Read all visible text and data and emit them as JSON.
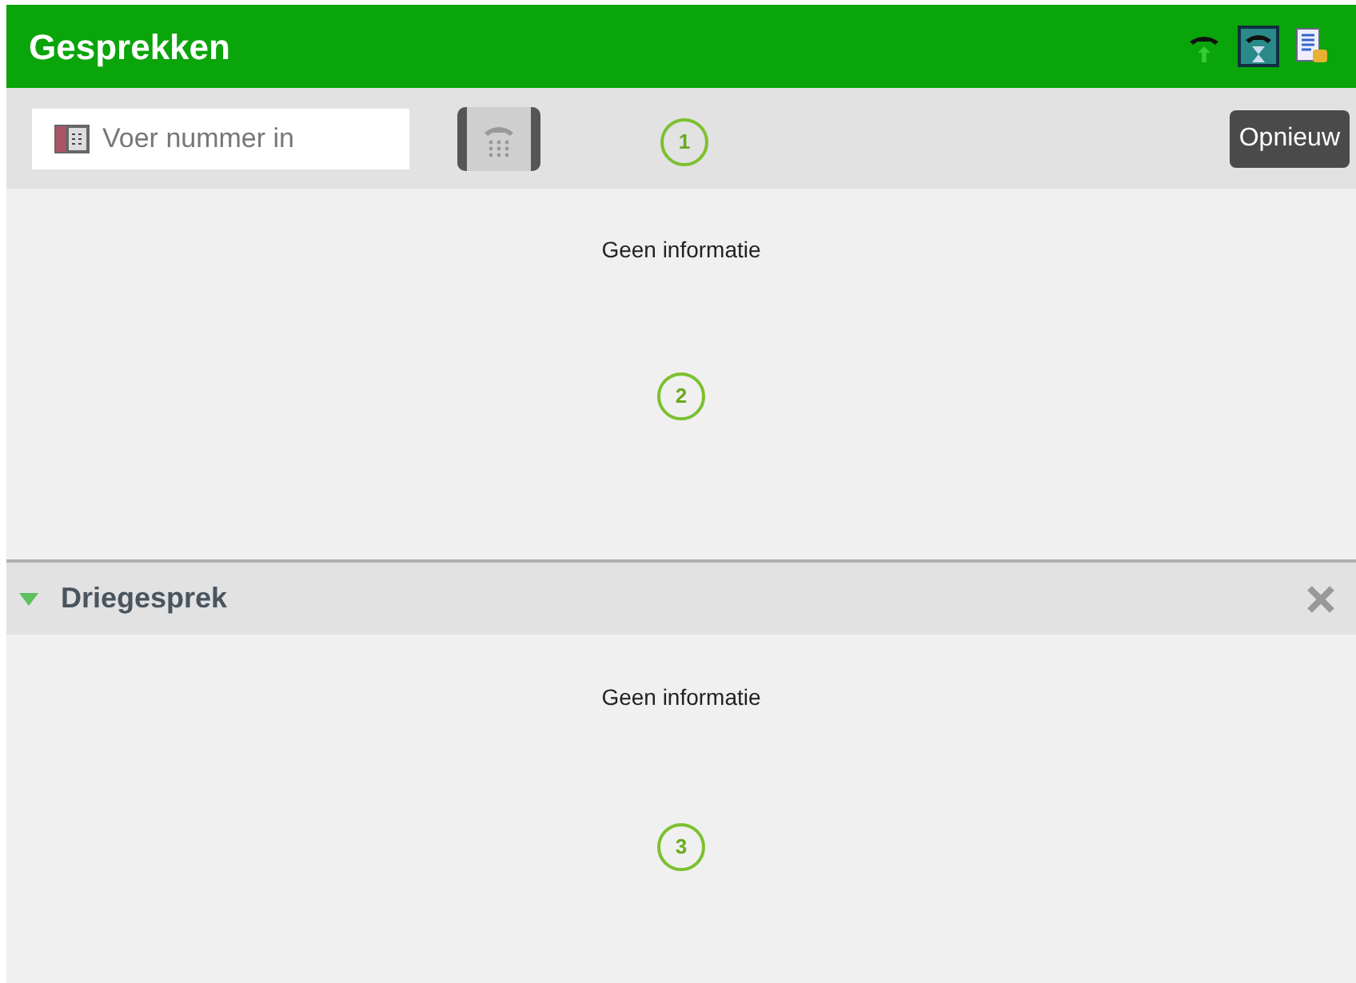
{
  "header": {
    "title": "Gesprekken"
  },
  "toolbar": {
    "number_field": {
      "placeholder": "Voer nummer in"
    },
    "refresh_button": "Opnieuw",
    "callout": "1"
  },
  "calls_panel": {
    "message": "Geen informatie",
    "callout": "2"
  },
  "conference_section": {
    "title": "Driegesprek",
    "expanded": true,
    "message": "Geen informatie",
    "callout": "3"
  }
}
